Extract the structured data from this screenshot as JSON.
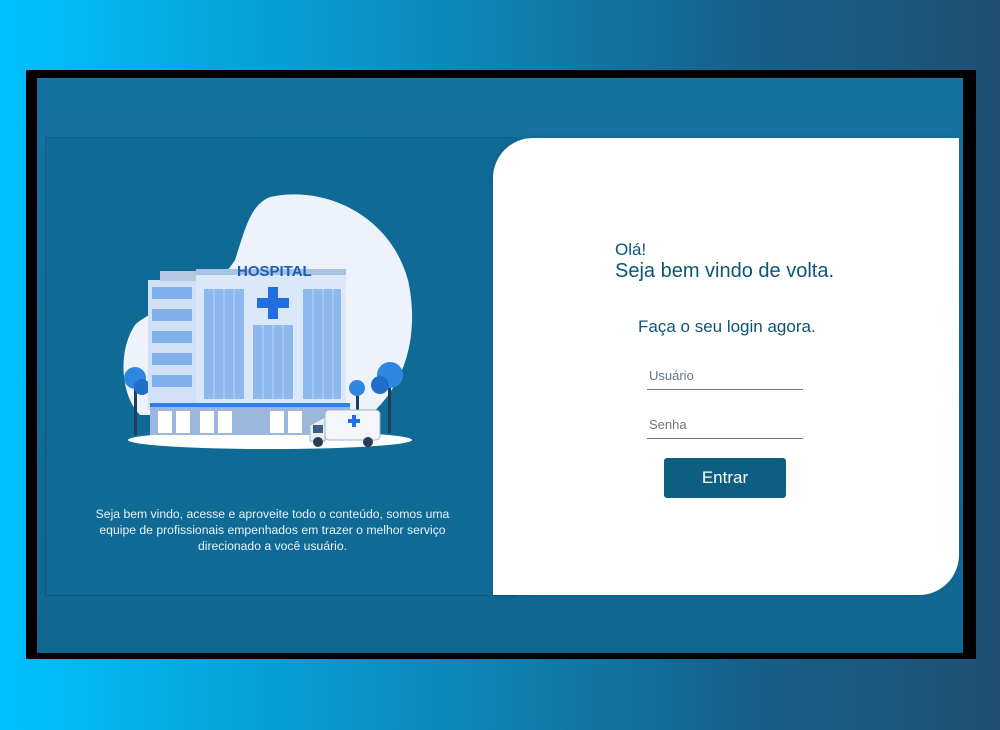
{
  "hero": {
    "sign_text": "HOSPITAL",
    "description": "Seja bem vindo, acesse e aproveite todo o conteúdo, somos uma equipe de profissionais empenhados em trazer o melhor serviço direcionado a você usuário."
  },
  "login": {
    "greeting_line1": "Olá!",
    "greeting_line2": "Seja bem vindo de volta.",
    "subtitle": "Faça o seu login agora.",
    "username_placeholder": "Usuário",
    "password_placeholder": "Senha",
    "submit_label": "Entrar"
  },
  "colors": {
    "brand_dark": "#0b5576",
    "button": "#0d5f82",
    "left_panel": "#0f6a95"
  },
  "icons": [
    "hospital-building-illustration",
    "ambulance-icon",
    "medical-cross-icon",
    "tree-icon"
  ]
}
